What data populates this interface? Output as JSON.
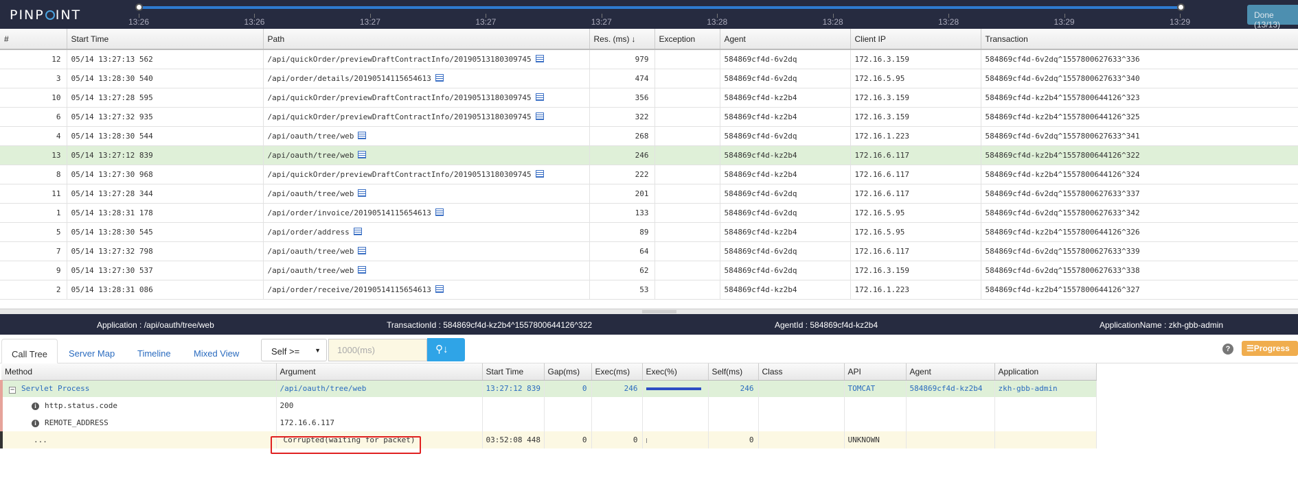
{
  "app": {
    "logo_text_pre": "PINP",
    "logo_text_post": "INT"
  },
  "timeline": {
    "labels": [
      "13:26",
      "13:26",
      "13:27",
      "13:27",
      "13:27",
      "13:28",
      "13:28",
      "13:28",
      "13:29",
      "13:29"
    ],
    "done_label": "Done (13/13)"
  },
  "tx_table": {
    "headers": [
      "#",
      "Start Time",
      "Path",
      "Res. (ms)",
      "Exception",
      "Agent",
      "Client IP",
      "Transaction"
    ],
    "rows": [
      [
        "12",
        "05/14 13:27:13 562",
        "/api/quickOrder/previewDraftContractInfo/20190513180309745",
        "979",
        "",
        "584869cf4d-6v2dq",
        "172.16.3.159",
        "584869cf4d-6v2dq^1557800627633^336"
      ],
      [
        "3",
        "05/14 13:28:30 540",
        "/api/order/details/20190514115654613",
        "474",
        "",
        "584869cf4d-6v2dq",
        "172.16.5.95",
        "584869cf4d-6v2dq^1557800627633^340"
      ],
      [
        "10",
        "05/14 13:27:28 595",
        "/api/quickOrder/previewDraftContractInfo/20190513180309745",
        "356",
        "",
        "584869cf4d-kz2b4",
        "172.16.3.159",
        "584869cf4d-kz2b4^1557800644126^323"
      ],
      [
        "6",
        "05/14 13:27:32 935",
        "/api/quickOrder/previewDraftContractInfo/20190513180309745",
        "322",
        "",
        "584869cf4d-kz2b4",
        "172.16.3.159",
        "584869cf4d-kz2b4^1557800644126^325"
      ],
      [
        "4",
        "05/14 13:28:30 544",
        "/api/oauth/tree/web",
        "268",
        "",
        "584869cf4d-6v2dq",
        "172.16.1.223",
        "584869cf4d-6v2dq^1557800627633^341"
      ],
      [
        "13",
        "05/14 13:27:12 839",
        "/api/oauth/tree/web",
        "246",
        "",
        "584869cf4d-kz2b4",
        "172.16.6.117",
        "584869cf4d-kz2b4^1557800644126^322"
      ],
      [
        "8",
        "05/14 13:27:30 968",
        "/api/quickOrder/previewDraftContractInfo/20190513180309745",
        "222",
        "",
        "584869cf4d-kz2b4",
        "172.16.6.117",
        "584869cf4d-kz2b4^1557800644126^324"
      ],
      [
        "11",
        "05/14 13:27:28 344",
        "/api/oauth/tree/web",
        "201",
        "",
        "584869cf4d-6v2dq",
        "172.16.6.117",
        "584869cf4d-6v2dq^1557800627633^337"
      ],
      [
        "1",
        "05/14 13:28:31 178",
        "/api/order/invoice/20190514115654613",
        "133",
        "",
        "584869cf4d-6v2dq",
        "172.16.5.95",
        "584869cf4d-6v2dq^1557800627633^342"
      ],
      [
        "5",
        "05/14 13:28:30 545",
        "/api/order/address",
        "89",
        "",
        "584869cf4d-kz2b4",
        "172.16.5.95",
        "584869cf4d-kz2b4^1557800644126^326"
      ],
      [
        "7",
        "05/14 13:27:32 798",
        "/api/oauth/tree/web",
        "64",
        "",
        "584869cf4d-6v2dq",
        "172.16.6.117",
        "584869cf4d-6v2dq^1557800627633^339"
      ],
      [
        "9",
        "05/14 13:27:30 537",
        "/api/oauth/tree/web",
        "62",
        "",
        "584869cf4d-6v2dq",
        "172.16.3.159",
        "584869cf4d-6v2dq^1557800627633^338"
      ],
      [
        "2",
        "05/14 13:28:31 086",
        "/api/order/receive/20190514115654613",
        "53",
        "",
        "584869cf4d-kz2b4",
        "172.16.1.223",
        "584869cf4d-kz2b4^1557800644126^327"
      ]
    ],
    "selected_row": 5
  },
  "infobar": {
    "application": "Application : /api/oauth/tree/web",
    "transaction_id": "TransactionId : 584869cf4d-kz2b4^1557800644126^322",
    "agent_id": "AgentId : 584869cf4d-kz2b4",
    "application_name": "ApplicationName : zkh-gbb-admin"
  },
  "tabs": [
    "Call Tree",
    "Server Map",
    "Timeline",
    "Mixed View"
  ],
  "filter": {
    "self_select": "Self >=",
    "gap_placeholder": "1000(ms)"
  },
  "progress_label": "Progress",
  "call_tree": {
    "headers": [
      "Method",
      "Argument",
      "Start Time",
      "Gap(ms)",
      "Exec(ms)",
      "Exec(%)",
      "Self(ms)",
      "Class",
      "API",
      "Agent",
      "Application"
    ],
    "root": {
      "method": "Servlet Process",
      "argument": "/api/oauth/tree/web",
      "start": "13:27:12 839",
      "gap": "0",
      "exec": "246",
      "exec_pct": 100,
      "self": "246",
      "class": "",
      "api": "TOMCAT",
      "agent": "584869cf4d-kz2b4",
      "application": "zkh-gbb-admin"
    },
    "attrs": [
      {
        "method": "http.status.code",
        "argument": "200"
      },
      {
        "method": "REMOTE_ADDRESS",
        "argument": "172.16.6.117"
      }
    ],
    "corrupt": {
      "method": "...",
      "argument": "Corrupted(waiting for packet)",
      "start": "03:52:08 448",
      "gap": "0",
      "exec": "0",
      "self": "0",
      "api": "UNKNOWN"
    }
  }
}
